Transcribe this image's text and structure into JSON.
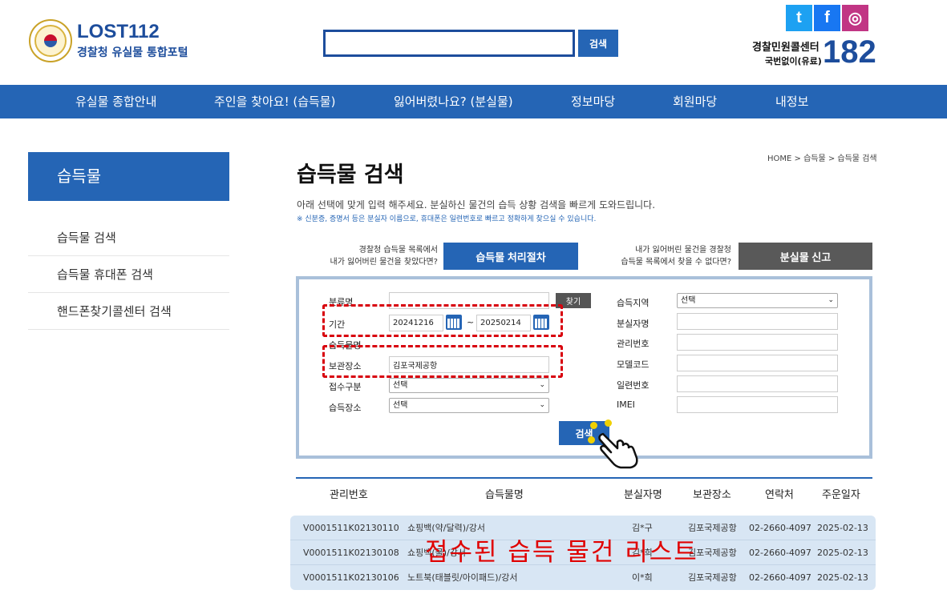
{
  "header": {
    "logo_title": "LOST112",
    "logo_sub": "경찰청 유실물 통합포털",
    "search_button": "검색",
    "search_value": "",
    "callcenter_label": "경찰민원콜센터",
    "callcenter_sub": "국번없이(유료)",
    "callcenter_number": "182",
    "sns": {
      "twitter": "t",
      "facebook": "f",
      "instagram": "◎"
    }
  },
  "nav": [
    "유실물 종합안내",
    "주인을 찾아요! (습득물)",
    "잃어버렸나요? (분실물)",
    "정보마당",
    "회원마당",
    "내정보"
  ],
  "sidebar": {
    "title": "습득물",
    "items": [
      "습득물 검색",
      "습득물 휴대폰 검색",
      "핸드폰찾기콜센터 검색"
    ]
  },
  "breadcrumb": "HOME > 습득물 > 습득물 검색",
  "page": {
    "title": "습득물 검색",
    "desc1": "아래 선택에 맞게 입력 해주세요. 분실하신 물건의 습득 상황 검색을 빠르게 도와드립니다.",
    "desc2": "※ 신분증, 증명서 등은 분실자 이름으로, 휴대폰은 일련번호로 빠르고 정확하게 찾으실 수 있습니다."
  },
  "promo": {
    "left_line1": "경찰청 습득물 목록에서",
    "left_line2": "내가 잃어버린 물건을 찾았다면?",
    "left_button": "습득물 처리절차",
    "right_line1": "내가 잃어버린 물건을 경찰청",
    "right_line2": "습득물 목록에서 찾을 수 없다면?",
    "right_button": "분실물 신고"
  },
  "form": {
    "category_label": "분류명",
    "category_value": "",
    "find_button": "찾기",
    "period_label": "기간",
    "date_from": "20241216",
    "date_to": "20250214",
    "tilde": "~",
    "item_name_label": "습득물명",
    "storage_label": "보관장소",
    "storage_value": "김포국제공항",
    "receipt_type_label": "접수구분",
    "receipt_type_value": "선택",
    "found_place_label": "습득장소",
    "found_place_value": "선택",
    "region_label": "습득지역",
    "region_value": "선택",
    "owner_label": "분실자명",
    "mgmt_no_label": "관리번호",
    "model_label": "모델코드",
    "serial_label": "일련번호",
    "imei_label": "IMEI",
    "submit": "검색"
  },
  "results": {
    "headers": [
      "관리번호",
      "습득물명",
      "분실자명",
      "보관장소",
      "연락처",
      "주운일자"
    ],
    "rows": [
      [
        "V0001511K02130110",
        "쇼핑백(약/달력)/강서",
        "김*구",
        "김포국제공항",
        "02-2660-4097",
        "2025-02-13"
      ],
      [
        "V0001511K02130108",
        "쇼핑백(물)/강서",
        "김*희",
        "김포국제공항",
        "02-2660-4097",
        "2025-02-13"
      ],
      [
        "V0001511K02130106",
        "노트북(태블릿/아이패드)/강서",
        "이*희",
        "김포국제공항",
        "02-2660-4097",
        "2025-02-13"
      ]
    ]
  },
  "overlay_caption": "접수된 습득 물건 리스트",
  "colors": {
    "brand": "#2565b5",
    "dark_brand": "#1d4d9c",
    "highlight": "#d8000c"
  }
}
